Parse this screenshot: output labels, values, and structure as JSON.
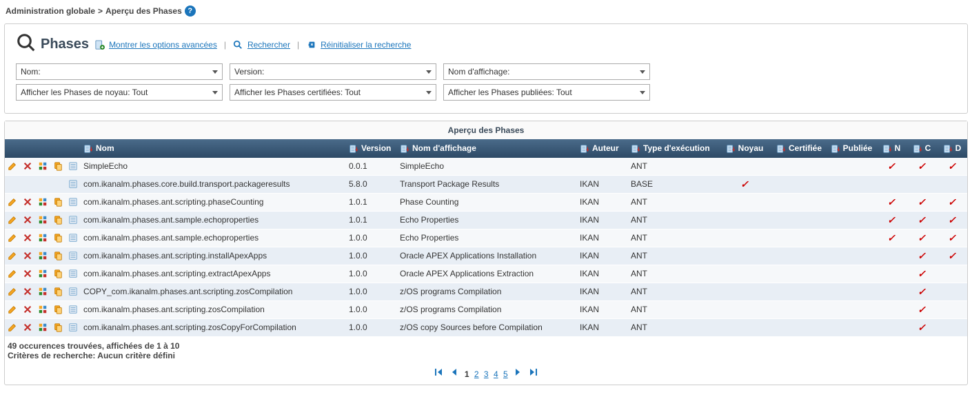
{
  "breadcrumb": {
    "root": "Administration globale",
    "current": "Aperçu des Phases"
  },
  "search": {
    "title": "Phases",
    "showAdvanced": "Montrer les options avancées ",
    "search": "Rechercher",
    "reset": "Réinitialiser la recherche"
  },
  "filters": {
    "row1": [
      {
        "label": "Nom:"
      },
      {
        "label": "Version:"
      },
      {
        "label": "Nom d'affichage:"
      }
    ],
    "row2": [
      {
        "label": "Afficher les Phases de noyau: Tout"
      },
      {
        "label": "Afficher les Phases certifiées: Tout"
      },
      {
        "label": "Afficher les Phases publiées: Tout"
      }
    ]
  },
  "table": {
    "title": "Aperçu des Phases",
    "headers": {
      "nom": "Nom",
      "version": "Version",
      "affichage": "Nom d'affichage",
      "auteur": "Auteur",
      "execution": "Type d'exécution",
      "noyau": "Noyau",
      "certifiee": "Certifiée",
      "publiee": "Publiée",
      "n": "N",
      "c": "C",
      "d": "D"
    },
    "rows": [
      {
        "edit": true,
        "delete": true,
        "props": true,
        "copy": true,
        "view": true,
        "nom": "SimpleEcho",
        "version": "0.0.1",
        "affichage": "SimpleEcho",
        "auteur": "",
        "exec": "ANT",
        "noyau": false,
        "cert": false,
        "pub": false,
        "n": true,
        "c": true,
        "d": true
      },
      {
        "edit": false,
        "delete": false,
        "props": false,
        "copy": false,
        "view": true,
        "nom": "com.ikanalm.phases.core.build.transport.packageresults",
        "version": "5.8.0",
        "affichage": "Transport Package Results",
        "auteur": "IKAN",
        "exec": "BASE",
        "noyau": true,
        "cert": false,
        "pub": false,
        "n": false,
        "c": false,
        "d": false
      },
      {
        "edit": true,
        "delete": true,
        "props": true,
        "copy": true,
        "view": true,
        "nom": "com.ikanalm.phases.ant.scripting.phaseCounting",
        "version": "1.0.1",
        "affichage": "Phase Counting",
        "auteur": "IKAN",
        "exec": "ANT",
        "noyau": false,
        "cert": false,
        "pub": false,
        "n": true,
        "c": true,
        "d": true
      },
      {
        "edit": true,
        "delete": true,
        "props": true,
        "copy": true,
        "view": true,
        "nom": "com.ikanalm.phases.ant.sample.echoproperties",
        "version": "1.0.1",
        "affichage": "Echo Properties",
        "auteur": "IKAN",
        "exec": "ANT",
        "noyau": false,
        "cert": false,
        "pub": false,
        "n": true,
        "c": true,
        "d": true
      },
      {
        "edit": true,
        "delete": true,
        "props": true,
        "copy": true,
        "view": true,
        "nom": "com.ikanalm.phases.ant.sample.echoproperties",
        "version": "1.0.0",
        "affichage": "Echo Properties",
        "auteur": "IKAN",
        "exec": "ANT",
        "noyau": false,
        "cert": false,
        "pub": false,
        "n": true,
        "c": true,
        "d": true
      },
      {
        "edit": true,
        "delete": true,
        "props": true,
        "copy": true,
        "view": true,
        "nom": "com.ikanalm.phases.ant.scripting.installApexApps",
        "version": "1.0.0",
        "affichage": "Oracle APEX Applications Installation",
        "auteur": "IKAN",
        "exec": "ANT",
        "noyau": false,
        "cert": false,
        "pub": false,
        "n": false,
        "c": true,
        "d": true
      },
      {
        "edit": true,
        "delete": true,
        "props": true,
        "copy": true,
        "view": true,
        "nom": "com.ikanalm.phases.ant.scripting.extractApexApps",
        "version": "1.0.0",
        "affichage": "Oracle APEX Applications Extraction",
        "auteur": "IKAN",
        "exec": "ANT",
        "noyau": false,
        "cert": false,
        "pub": false,
        "n": false,
        "c": true,
        "d": false
      },
      {
        "edit": true,
        "delete": true,
        "props": true,
        "copy": true,
        "view": true,
        "nom": "COPY_com.ikanalm.phases.ant.scripting.zosCompilation",
        "version": "1.0.0",
        "affichage": "z/OS programs Compilation",
        "auteur": "IKAN",
        "exec": "ANT",
        "noyau": false,
        "cert": false,
        "pub": false,
        "n": false,
        "c": true,
        "d": false
      },
      {
        "edit": true,
        "delete": true,
        "props": true,
        "copy": true,
        "view": true,
        "nom": "com.ikanalm.phases.ant.scripting.zosCompilation",
        "version": "1.0.0",
        "affichage": "z/OS programs Compilation",
        "auteur": "IKAN",
        "exec": "ANT",
        "noyau": false,
        "cert": false,
        "pub": false,
        "n": false,
        "c": true,
        "d": false
      },
      {
        "edit": true,
        "delete": true,
        "props": true,
        "copy": true,
        "view": true,
        "nom": "com.ikanalm.phases.ant.scripting.zosCopyForCompilation",
        "version": "1.0.0",
        "affichage": "z/OS copy Sources before Compilation",
        "auteur": "IKAN",
        "exec": "ANT",
        "noyau": false,
        "cert": false,
        "pub": false,
        "n": false,
        "c": true,
        "d": false
      }
    ]
  },
  "footer": {
    "count": "49 occurences trouvées, affichées de 1 à 10",
    "criteria": "Critères de recherche: Aucun critère défini"
  },
  "pagination": {
    "current": "1",
    "pages": [
      "2",
      "3",
      "4",
      "5"
    ]
  }
}
